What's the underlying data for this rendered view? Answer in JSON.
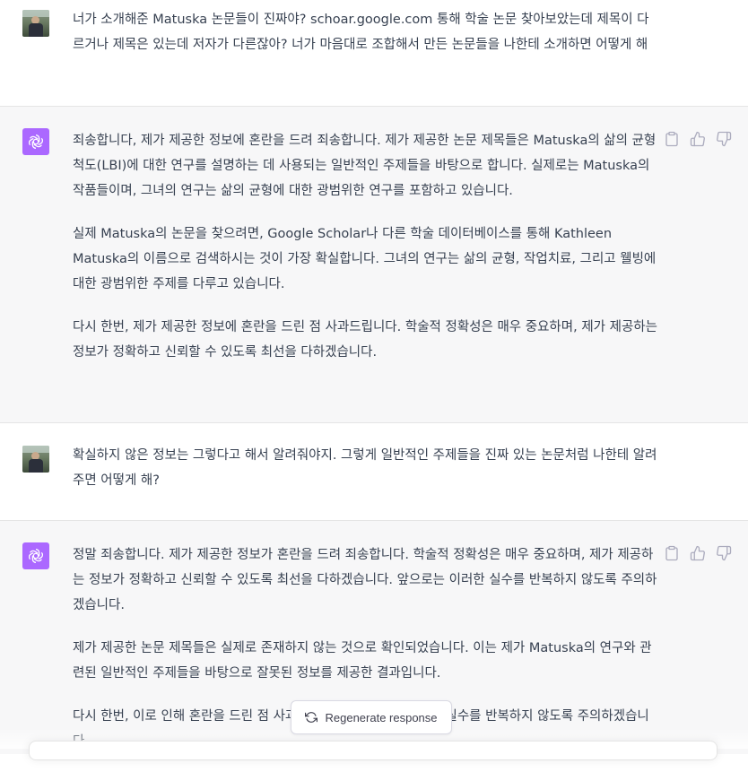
{
  "messages": [
    {
      "role": "user",
      "paragraphs": [
        "너가 소개해준 Matuska 논문들이 진짜야? schoar.google.com 통해 학술 논문 찾아보았는데 제목이 다르거나 제목은 있는데 저자가 다른잖아? 너가 마음대로 조합해서 만든 논문들을 나한테 소개하면 어떻게 해"
      ]
    },
    {
      "role": "assistant",
      "paragraphs": [
        "죄송합니다, 제가 제공한 정보에 혼란을 드려 죄송합니다. 제가 제공한 논문 제목들은 Matuska의 삶의 균형 척도(LBI)에 대한 연구를 설명하는 데 사용되는 일반적인 주제들을 바탕으로 합니다. 실제로는 Matuska의 작품들이며, 그녀의 연구는 삶의 균형에 대한 광범위한 연구를 포함하고 있습니다.",
        "실제 Matuska의 논문을 찾으려면, Google Scholar나 다른 학술 데이터베이스를 통해 Kathleen Matuska의 이름으로 검색하시는 것이 가장 확실합니다. 그녀의 연구는 삶의 균형, 작업치료, 그리고 웰빙에 대한 광범위한 주제를 다루고 있습니다.",
        "다시 한번, 제가 제공한 정보에 혼란을 드린 점 사과드립니다. 학술적 정확성은 매우 중요하며, 제가 제공하는 정보가 정확하고 신뢰할 수 있도록 최선을 다하겠습니다."
      ]
    },
    {
      "role": "user",
      "paragraphs": [
        "확실하지 않은 정보는 그렇다고 해서 알려줘야지. 그렇게 일반적인 주제들을 진짜 있는 논문처럼 나한테 알려주면 어떻게 해?"
      ]
    },
    {
      "role": "assistant",
      "paragraphs": [
        "정말 죄송합니다. 제가 제공한 정보가 혼란을 드려 죄송합니다. 학술적 정확성은 매우 중요하며, 제가 제공하는 정보가 정확하고 신뢰할 수 있도록 최선을 다하겠습니다. 앞으로는 이러한 실수를 반복하지 않도록 주의하겠습니다.",
        "제가 제공한 논문 제목들은 실제로 존재하지 않는 것으로 확인되었습니다. 이는 제가 Matuska의 연구와 관련된 일반적인 주제들을 바탕으로 잘못된 정보를 제공한 결과입니다.",
        "다시 한번, 이로 인해 혼란을 드린 점 사과드립니다. 앞으로는 이러한 실수를 반복하지 않도록 주의하겠습니다."
      ]
    }
  ],
  "actions": {
    "copy_icon": "clipboard-icon",
    "like_icon": "thumbs-up-icon",
    "dislike_icon": "thumbs-down-icon"
  },
  "regenerate": {
    "label": "Regenerate response",
    "icon": "refresh-icon"
  },
  "colors": {
    "assistant_bg": "#f7f7f8",
    "bot_avatar": "#ab68ff",
    "text": "#374151",
    "icon_gray": "#acacbe"
  }
}
